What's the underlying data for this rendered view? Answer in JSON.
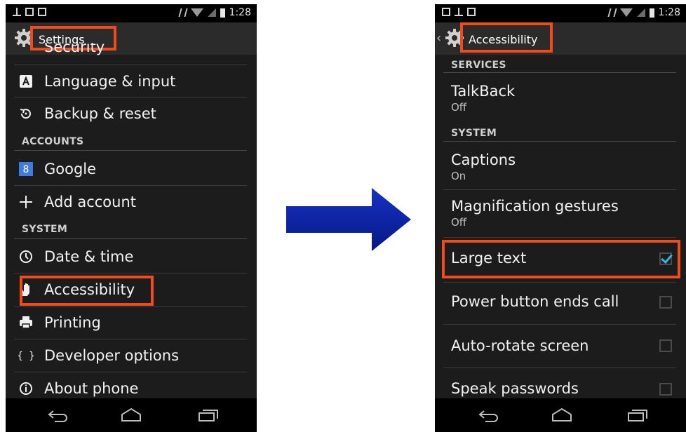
{
  "left_screen": {
    "status_time": "1:28",
    "title": "Settings",
    "partial_item": "Security",
    "items_top": [
      {
        "label": "Language & input",
        "icon": "language-icon"
      },
      {
        "label": "Backup & reset",
        "icon": "backup-icon"
      }
    ],
    "section_accounts": "ACCOUNTS",
    "accounts_items": [
      {
        "label": "Google",
        "icon": "google-icon"
      },
      {
        "label": "Add account",
        "icon": "plus-icon"
      }
    ],
    "section_system": "SYSTEM",
    "system_items": [
      {
        "label": "Date & time",
        "icon": "clock-icon"
      },
      {
        "label": "Accessibility",
        "icon": "hand-icon"
      },
      {
        "label": "Printing",
        "icon": "printer-icon"
      },
      {
        "label": "Developer options",
        "icon": "braces-icon"
      },
      {
        "label": "About phone",
        "icon": "info-icon"
      }
    ]
  },
  "right_screen": {
    "status_time": "1:28",
    "title": "Accessibility",
    "section_services": "SERVICES",
    "talkback": {
      "title": "TalkBack",
      "summary": "Off"
    },
    "section_system": "SYSTEM",
    "captions": {
      "title": "Captions",
      "summary": "On"
    },
    "magnification": {
      "title": "Magnification gestures",
      "summary": "Off"
    },
    "checkbox_items": [
      {
        "title": "Large text",
        "checked": true
      },
      {
        "title": "Power button ends call",
        "checked": false
      },
      {
        "title": "Auto-rotate screen",
        "checked": false
      },
      {
        "title": "Speak passwords",
        "checked": false
      }
    ]
  },
  "colors": {
    "highlight": "#f04b1c",
    "arrow": "#0b1f9c",
    "check_accent": "#33b5e5"
  }
}
